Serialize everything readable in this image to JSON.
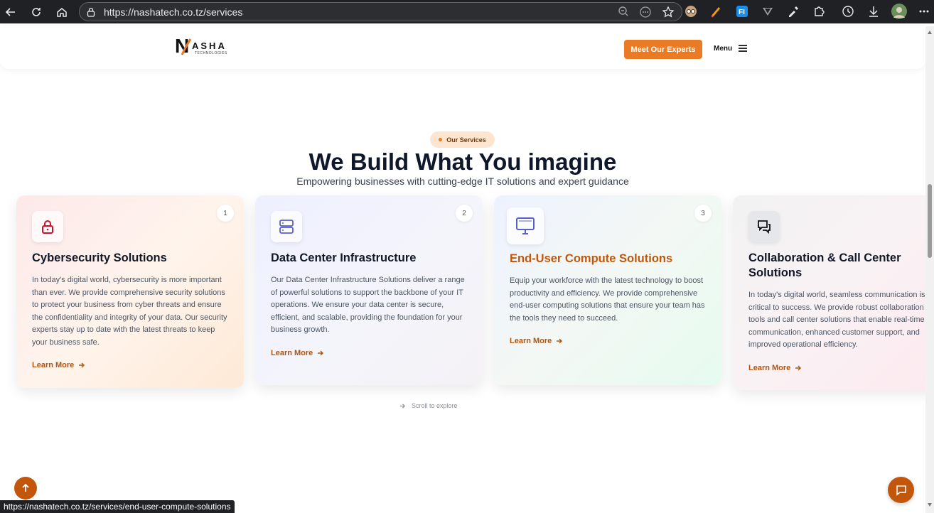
{
  "browser": {
    "url": "https://nashatech.co.tz/services",
    "status_url": "https://nashatech.co.tz/services/end-user-compute-solutions"
  },
  "header": {
    "logo_mark": "N",
    "logo_word": "ASHA",
    "logo_sub": "TECHNOLOGIES",
    "cta_label": "Meet Our Experts",
    "menu_label": "Menu"
  },
  "section": {
    "pill": "Our Services",
    "title": "We Build What You imagine",
    "subtitle": "Empowering businesses with cutting-edge IT solutions and expert guidance",
    "scroll_hint": "Scroll to explore"
  },
  "cards": [
    {
      "number": "1",
      "icon": "lock-icon",
      "title": "Cybersecurity Solutions",
      "body": "In today's digital world, cybersecurity is more important than ever. We provide comprehensive security solutions to protect your business from cyber threats and ensure the confidentiality and integrity of your data. Our security experts stay up to date with the latest threats to keep your business safe.",
      "link": "Learn More"
    },
    {
      "number": "2",
      "icon": "server-icon",
      "title": "Data Center Infrastructure",
      "body": "Our Data Center Infrastructure Solutions deliver a range of powerful solutions to support the backbone of your IT operations. We ensure your data center is secure, efficient, and scalable, providing the foundation for your business growth.",
      "link": "Learn More"
    },
    {
      "number": "3",
      "icon": "monitor-icon",
      "title": "End-User Compute Solutions",
      "body": "Equip your workforce with the latest technology to boost productivity and efficiency. We provide comprehensive end-user computing solutions that ensure your team has the tools they need to succeed.",
      "link": "Learn More"
    },
    {
      "icon": "chat-bubbles-icon",
      "title": "Collaboration & Call Center Solutions",
      "body": "In today's digital world, seamless communication is critical to success. We provide robust collaboration tools and call center solutions that enable real-time communication, enhanced customer support, and improved operational efficiency.",
      "link": "Learn More"
    }
  ],
  "colors": {
    "accent": "#ea7a24",
    "accent_dark": "#c2570c",
    "lock_icon": "#d0102b",
    "server_icon": "#5b5fc7"
  }
}
